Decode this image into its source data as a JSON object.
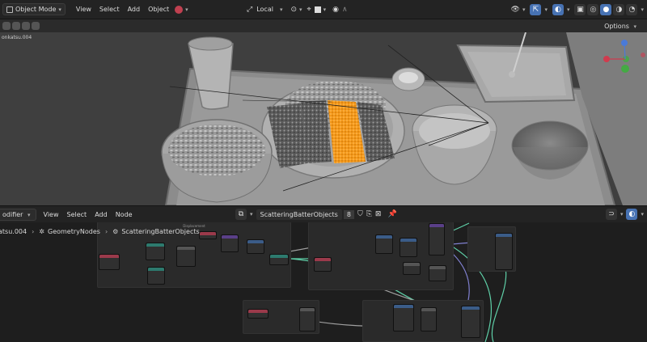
{
  "header": {
    "mode": "Object Mode",
    "menu": [
      "View",
      "Select",
      "Add",
      "Object"
    ],
    "transform_orientation": "Local",
    "options_label": "Options"
  },
  "viewport": {
    "object_label": "onkatsu.004",
    "accent_colors": {
      "selection": "#f59a1c",
      "background": "#3f3f3f"
    }
  },
  "node_editor": {
    "editor_type": "odifier",
    "menu": [
      "View",
      "Select",
      "Add",
      "Node"
    ],
    "node_group_name": "ScatteringBatterObjects",
    "user_count": "8",
    "breadcrumb": [
      "atsu.004",
      "GeometryNodes",
      "ScatteringBatterObjects"
    ],
    "frames": [
      "Displacement"
    ]
  }
}
